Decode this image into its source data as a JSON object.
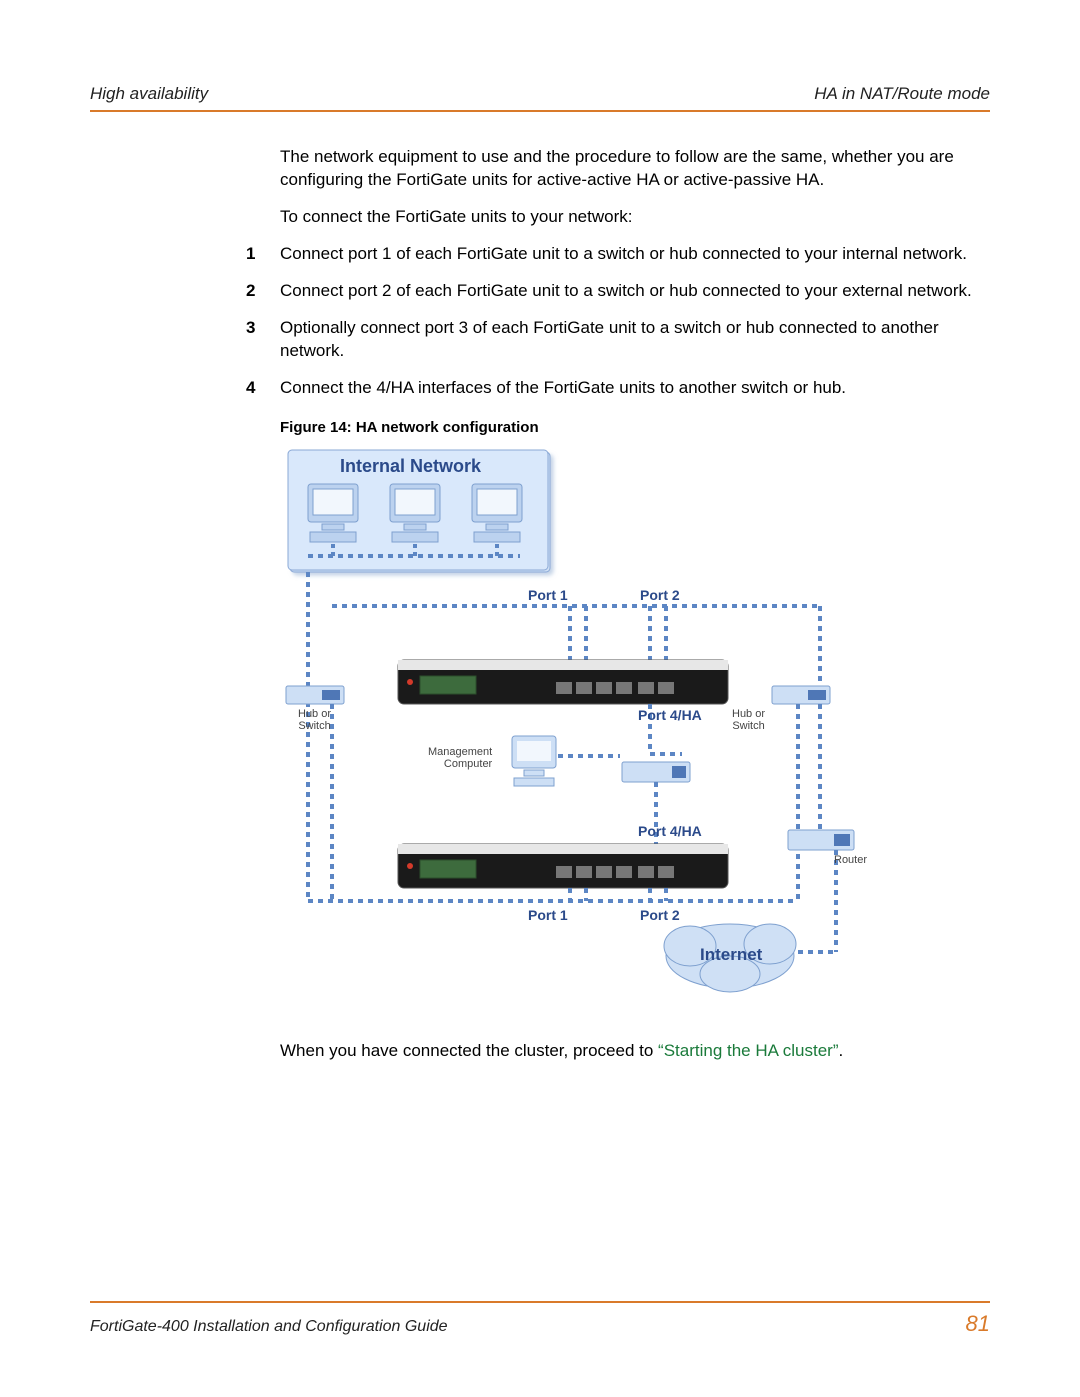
{
  "header": {
    "left": "High availability",
    "right": "HA in NAT/Route mode"
  },
  "body": {
    "intro_para": "The network equipment to use and the procedure to follow are the same, whether you are configuring the FortiGate units for active-active HA or active-passive HA.",
    "lead_in": "To connect the FortiGate units to your network:",
    "steps": [
      {
        "num": "1",
        "text": "Connect port 1 of each FortiGate unit to a switch or hub connected to your internal network."
      },
      {
        "num": "2",
        "text": "Connect port 2 of each FortiGate unit to a switch or hub connected to your external network."
      },
      {
        "num": "3",
        "text": "Optionally connect port 3 of each FortiGate unit to a switch or hub connected to another network."
      },
      {
        "num": "4",
        "text": "Connect the 4/HA interfaces of the FortiGate units to another switch or hub."
      }
    ],
    "figure_caption": "Figure 14: HA network configuration",
    "after_figure_pre": "When you have connected the cluster, proceed to ",
    "after_figure_link": "“Starting the HA cluster”",
    "after_figure_post": "."
  },
  "figure": {
    "internal_network": "Internal Network",
    "port1_top": "Port 1",
    "port2_top": "Port 2",
    "port4ha_top": "Port 4/HA",
    "port4ha_bottom": "Port 4/HA",
    "port1_bottom": "Port 1",
    "port2_bottom": "Port 2",
    "hub_switch_left": "Hub or\nSwitch",
    "hub_switch_right": "Hub or\nSwitch",
    "management_computer": "Management\nComputer",
    "router": "Router",
    "internet": "Internet"
  },
  "footer": {
    "title": "FortiGate-400 Installation and Configuration Guide",
    "page": "81"
  }
}
